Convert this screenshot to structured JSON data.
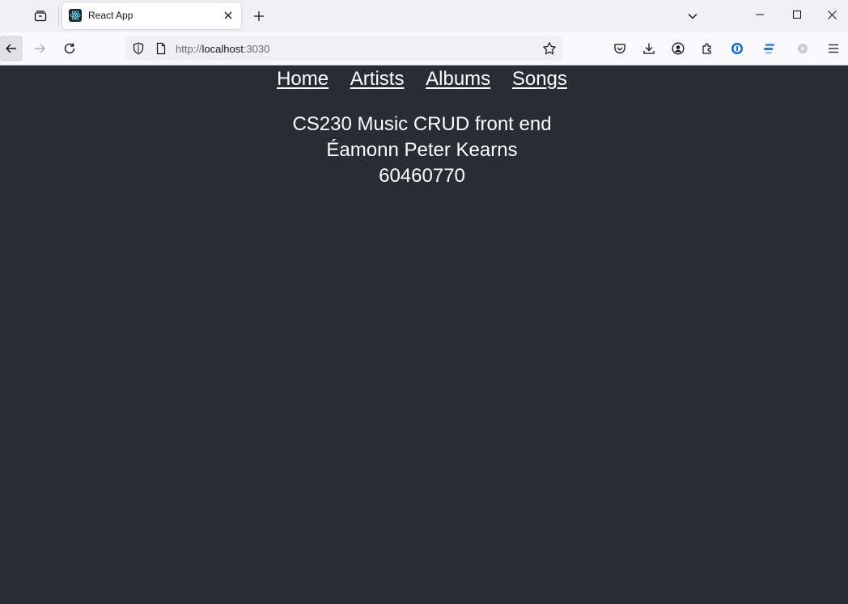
{
  "browser": {
    "tab": {
      "title": "React App"
    },
    "address": {
      "scheme": "http://",
      "host": "localhost",
      "port": ":3030"
    }
  },
  "page": {
    "nav": [
      {
        "label": "Home"
      },
      {
        "label": "Artists"
      },
      {
        "label": "Albums"
      },
      {
        "label": "Songs"
      }
    ],
    "info": {
      "title": "CS230 Music CRUD front end",
      "author": "Éamonn Peter Kearns",
      "student_id": "60460770"
    }
  },
  "colors": {
    "page_background": "#282c34",
    "text": "#ffffff",
    "tabstrip": "#f0f0f4",
    "toolbar": "#f9f9fb",
    "accent_blue": "#0060df"
  },
  "icons": [
    "tabs-list-icon",
    "react-favicon-icon",
    "close-icon",
    "plus-icon",
    "chevron-down-icon",
    "minimize-icon",
    "maximize-icon",
    "window-close-icon",
    "back-arrow-icon",
    "forward-arrow-icon",
    "reload-icon",
    "shield-icon",
    "page-icon",
    "star-icon",
    "pocket-icon",
    "download-icon",
    "account-icon",
    "extensions-icon",
    "password-manager-icon",
    "sidebar-extension-icon",
    "privacy-extension-icon",
    "menu-icon"
  ]
}
